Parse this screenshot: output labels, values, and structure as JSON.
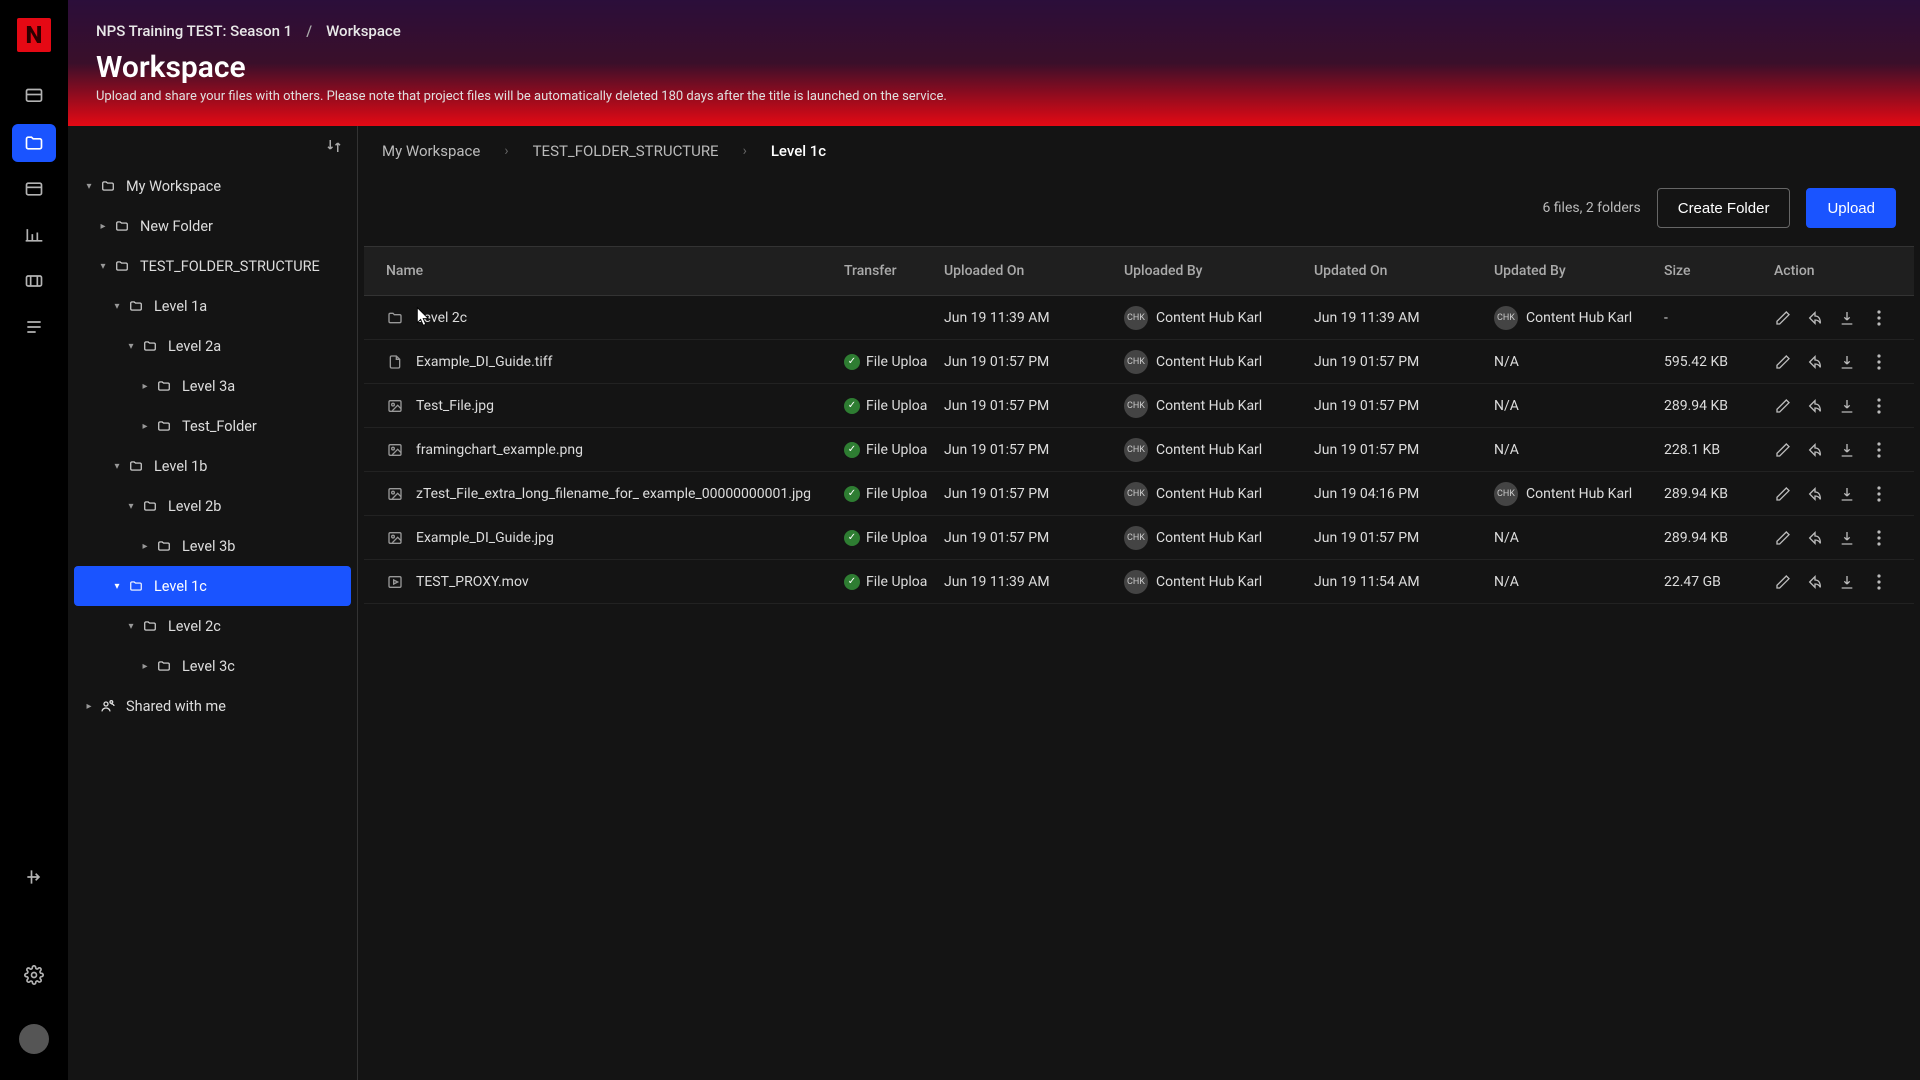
{
  "breadcrumb_top": {
    "project": "NPS Training TEST: Season 1",
    "section": "Workspace"
  },
  "header": {
    "title": "Workspace",
    "subtitle": "Upload and share your files with others. Please note that project files will be automatically deleted 180 days after the title is launched on the service."
  },
  "tree": {
    "root": "My Workspace",
    "shared": "Shared with me",
    "nodes": {
      "new_folder": "New Folder",
      "test_struct": "TEST_FOLDER_STRUCTURE",
      "l1a": "Level 1a",
      "l2a": "Level 2a",
      "l3a": "Level 3a",
      "test_folder": "Test_Folder",
      "l1b": "Level 1b",
      "l2b": "Level 2b",
      "l3b": "Level 3b",
      "l1c": "Level 1c",
      "l2c": "Level 2c",
      "l3c": "Level 3c"
    }
  },
  "crumbs2": {
    "a": "My Workspace",
    "b": "TEST_FOLDER_STRUCTURE",
    "c": "Level 1c"
  },
  "summary": "6 files, 2 folders",
  "buttons": {
    "create": "Create Folder",
    "upload": "Upload"
  },
  "columns": {
    "name": "Name",
    "transfer": "Transfer",
    "uploadedOn": "Uploaded On",
    "uploadedBy": "Uploaded By",
    "updatedOn": "Updated On",
    "updatedBy": "Updated By",
    "size": "Size",
    "action": "Action"
  },
  "user": {
    "initials": "CHK",
    "name": "Content Hub Karl"
  },
  "na": "N/A",
  "dash": "-",
  "transfer_label": "File Uploa",
  "rows": [
    {
      "kind": "folder",
      "name": "Level 2c",
      "uploadedOn": "Jun 19 11:39 AM",
      "updatedOn": "Jun 19 11:39 AM",
      "updatedByUser": true,
      "size": "-"
    },
    {
      "kind": "file",
      "name": "Example_DI_Guide.tiff",
      "uploadedOn": "Jun 19 01:57 PM",
      "updatedOn": "Jun 19 01:57 PM",
      "size": "595.42 KB"
    },
    {
      "kind": "image",
      "name": "Test_File.jpg",
      "uploadedOn": "Jun 19 01:57 PM",
      "updatedOn": "Jun 19 01:57 PM",
      "size": "289.94 KB"
    },
    {
      "kind": "image",
      "name": "framingchart_example.png",
      "uploadedOn": "Jun 19 01:57 PM",
      "updatedOn": "Jun 19 01:57 PM",
      "size": "228.1 KB"
    },
    {
      "kind": "image",
      "name": "zTest_File_extra_long_filename_for_ example_00000000001.jpg",
      "uploadedOn": "Jun 19 01:57 PM",
      "updatedOn": "Jun 19 04:16 PM",
      "updatedByUser": true,
      "size": "289.94 KB"
    },
    {
      "kind": "image",
      "name": "Example_DI_Guide.jpg",
      "uploadedOn": "Jun 19 01:57 PM",
      "updatedOn": "Jun 19 01:57 PM",
      "size": "289.94 KB"
    },
    {
      "kind": "video",
      "name": "TEST_PROXY.mov",
      "uploadedOn": "Jun 19 11:39 AM",
      "updatedOn": "Jun 19 11:54 AM",
      "size": "22.47 GB"
    }
  ]
}
